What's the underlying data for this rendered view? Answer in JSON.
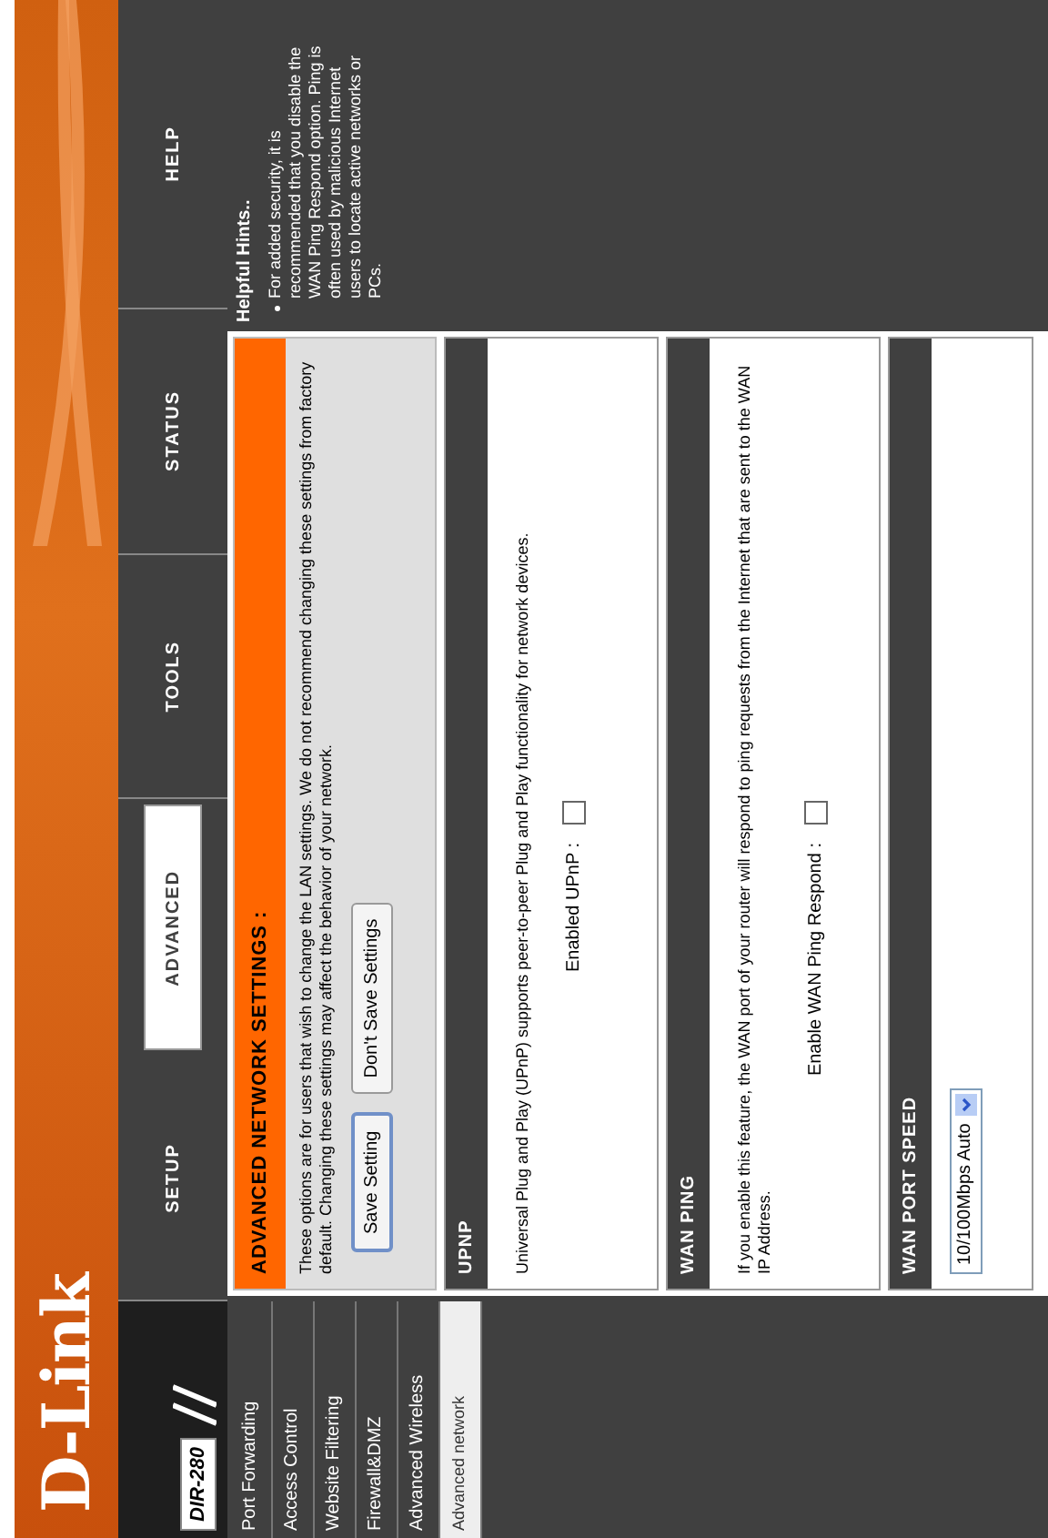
{
  "logo": "D-Link",
  "model": "DIR-280",
  "tabs": [
    {
      "label": "SETUP",
      "selected": false
    },
    {
      "label": "ADVANCED",
      "selected": true
    },
    {
      "label": "TOOLS",
      "selected": false
    },
    {
      "label": "STATUS",
      "selected": false
    },
    {
      "label": "HELP",
      "selected": false
    }
  ],
  "sidebar": {
    "items": [
      {
        "label": "Port Forwarding",
        "selected": false
      },
      {
        "label": "Access Control",
        "selected": false
      },
      {
        "label": "Website Filtering",
        "selected": false
      },
      {
        "label": "Firewall&DMZ",
        "selected": false
      },
      {
        "label": "Advanced Wireless",
        "selected": false
      },
      {
        "label": "Advanced network",
        "selected": true
      }
    ]
  },
  "sections": [
    {
      "kind": "intro",
      "title": "ADVANCED NETWORK SETTINGS :",
      "text": "These options are for users that wish to change the LAN settings. We do not recommend changing these settings from factory default. Changing these settings may affect the behavior of your network.",
      "buttons": [
        "Save Setting",
        "Don't Save Settings"
      ]
    },
    {
      "kind": "checkbox",
      "title": "UPNP",
      "text": "Universal Plug and Play (UPnP) supports peer-to-peer Plug and Play functionality for network devices.",
      "field_label": "Enabled UPnP :",
      "checked": false
    },
    {
      "kind": "checkbox",
      "title": "WAN PING",
      "text": "If you enable this feature, the WAN port of your router will respond to ping requests from the Internet that are sent to the WAN IP Address.",
      "field_label": "Enable WAN Ping Respond :",
      "checked": false
    },
    {
      "kind": "select",
      "title": "WAN PORT SPEED",
      "value": "10/100Mbps Auto"
    }
  ],
  "help": {
    "title": "Helpful Hints..",
    "text": "For added security, it is recommended that you disable the WAN Ping Respond option. Ping is often used by malicious Internet users to locate active networks or PCs."
  }
}
